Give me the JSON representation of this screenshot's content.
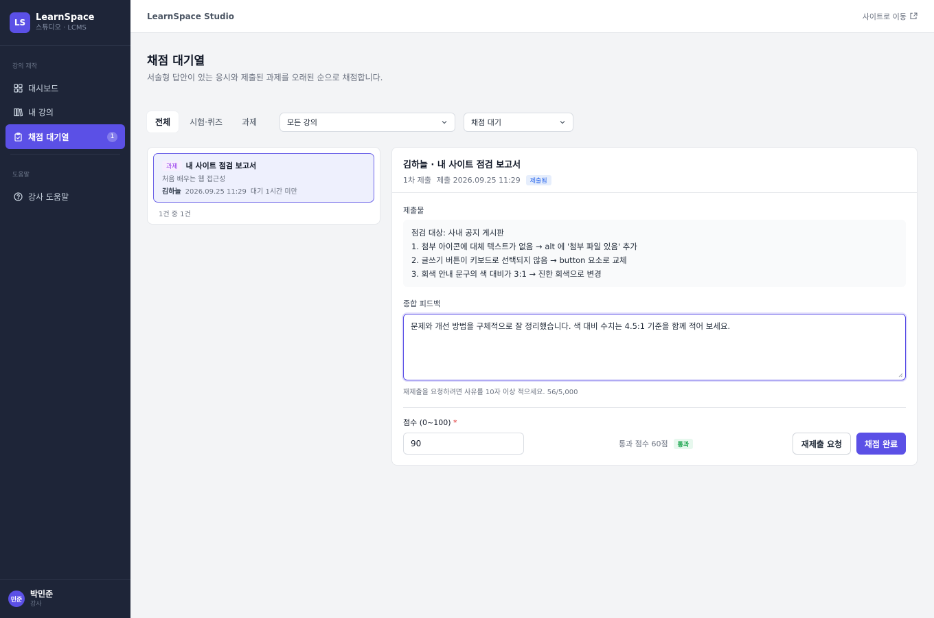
{
  "brand": {
    "logo": "LS",
    "name": "LearnSpace",
    "subtitle": "스튜디오 · LCMS"
  },
  "sidebar": {
    "section1": "강의 제작",
    "items": [
      {
        "label": "대시보드",
        "icon": "grid-icon"
      },
      {
        "label": "내 강의",
        "icon": "books-icon"
      },
      {
        "label": "채점 대기열",
        "icon": "clipboard-check-icon",
        "badge": "1",
        "active": true
      }
    ],
    "section2": "도움말",
    "help": {
      "label": "강사 도움말",
      "icon": "help-circle-icon"
    }
  },
  "user": {
    "initials": "민준",
    "name": "박민준",
    "role": "강사"
  },
  "topbar": {
    "title": "LearnSpace Studio",
    "link": "사이트로 이동"
  },
  "page": {
    "title": "채점 대기열",
    "description": "서술형 답안이 있는 응시와 제출된 과제를 오래된 순으로 채점합니다."
  },
  "tabs": [
    "전체",
    "시험·퀴즈",
    "과제"
  ],
  "filters": {
    "course": "모든 강의",
    "status": "채점 대기"
  },
  "queue": {
    "items": [
      {
        "type": "과제",
        "title": "내 사이트 점검 보고서",
        "course": "처음 배우는 웹 접근성",
        "student": "김하늘",
        "submitted": "2026.09.25 11:29",
        "wait": "대기 1시간 미만"
      }
    ],
    "count": "1건 중 1건"
  },
  "detail": {
    "title": "김하늘 · 내 사이트 점검 보고서",
    "attempt": "1차 제출",
    "submitted": "제출 2026.09.25 11:29",
    "status": "제출됨",
    "submission_label": "제출물",
    "submission_lines": [
      "점검 대상: 사내 공지 게시판",
      "1. 첨부 아이콘에 대체 텍스트가 없음 → alt 에 '첨부 파일 있음' 추가",
      "2. 글쓰기 버튼이 키보드로 선택되지 않음 → button 요소로 교체",
      "3. 회색 안내 문구의 색 대비가 3:1 → 진한 회색으로 변경"
    ],
    "feedback_label": "종합 피드백",
    "feedback": "문제와 개선 방법을 구체적으로 잘 정리했습니다. 색 대비 수치는 4.5:1 기준을 함께 적어 보세요.",
    "hint": "재제출을 요청하려면 사유를 10자 이상 적으세요. 56/5,000",
    "score_label": "점수 (0~100)",
    "required_mark": "*",
    "score": "90",
    "pass_info": "통과 점수 60점",
    "pass_badge": "통과",
    "resubmit_button": "재제출 요청",
    "complete_button": "채점 완료"
  },
  "colors": {
    "accent": "#5b50e6",
    "sidebar": "#1e2538"
  }
}
